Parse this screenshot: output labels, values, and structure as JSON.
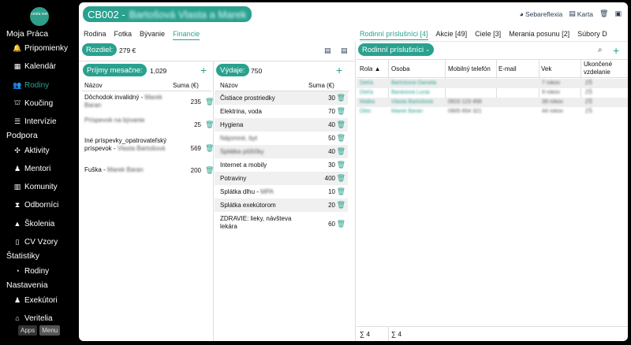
{
  "sidebar": {
    "logo_text": "cesta von",
    "sections": [
      {
        "title": "Moja Práca",
        "items": [
          {
            "label": "Pripomienky",
            "icon": "bell-icon"
          },
          {
            "label": "Kalendár",
            "icon": "calendar-icon"
          },
          {
            "label": "Rodiny",
            "icon": "users-icon",
            "active": true
          },
          {
            "label": "Koučing",
            "icon": "group-icon"
          },
          {
            "label": "Intervízie",
            "icon": "list-icon"
          }
        ]
      },
      {
        "title": "Podpora",
        "items": [
          {
            "label": "Aktivity",
            "icon": "puzzle-icon"
          },
          {
            "label": "Mentori",
            "icon": "person-icon"
          },
          {
            "label": "Komunity",
            "icon": "map-icon"
          },
          {
            "label": "Odborníci",
            "icon": "hourglass-icon"
          },
          {
            "label": "Školenia",
            "icon": "graduation-icon"
          },
          {
            "label": "CV Vzory",
            "icon": "document-icon"
          }
        ]
      },
      {
        "title": "Štatistiky",
        "items": [
          {
            "label": "Rodiny",
            "icon": "chart-icon"
          }
        ]
      },
      {
        "title": "Nastavenia",
        "items": [
          {
            "label": "Exekútori",
            "icon": "person-icon"
          },
          {
            "label": "Veritelia",
            "icon": "bank-icon"
          }
        ]
      }
    ],
    "apps_label": "Apps",
    "menu_label": "Menu"
  },
  "header": {
    "code": "CB002 -",
    "name": "Bartošová Vlasta a Marek",
    "actions": {
      "sebareflexia": "Sebareflexia",
      "karta": "Karta"
    }
  },
  "left_tabs": [
    "Rodina",
    "Fotka",
    "Bývanie",
    "Financie"
  ],
  "right_tabs": [
    "Rodinní príslušníci [4]",
    "Akcie [49]",
    "Ciele [3]",
    "Merania posunu [2]",
    "Súbory D"
  ],
  "finance": {
    "rozdiel_label": "Rozdiel:",
    "rozdiel_value": "279 €",
    "income": {
      "label": "Príjmy mesačne:",
      "total": "1,029",
      "col_name": "Názov",
      "col_sum": "Suma (€)",
      "rows": [
        {
          "name": "Dôchodok invalidný -",
          "name_blur": "Marek Baran",
          "amount": "235"
        },
        {
          "name": "",
          "name_blur": "Príspevok na bývanie",
          "amount": "25"
        },
        {
          "name": "Iné príspevky_opatrovateľský príspevok -",
          "name_blur": "Vlasta Bartošová",
          "amount": "569"
        },
        {
          "name": "Fuška -",
          "name_blur": "Marek Baran",
          "amount": "200"
        }
      ]
    },
    "expenses": {
      "label": "Výdaje:",
      "total": "750",
      "col_name": "Názov",
      "col_sum": "Suma (€)",
      "rows": [
        {
          "name": "Čistiace prostriedky",
          "amount": "30"
        },
        {
          "name": "Elektrina, voda",
          "amount": "70"
        },
        {
          "name": "Hygiena",
          "amount": "40"
        },
        {
          "name": "",
          "name_blur": "Nájomné, byt",
          "amount": "50"
        },
        {
          "name": "",
          "name_blur": "Splátka pôžičky",
          "amount": "40"
        },
        {
          "name": "Internet a mobily",
          "amount": "30"
        },
        {
          "name": "Potraviny",
          "amount": "400"
        },
        {
          "name": "Splátka dlhu -",
          "name_blur": "MPA",
          "amount": "10"
        },
        {
          "name": "Splátka exekútorom",
          "amount": "20"
        },
        {
          "name": "ZDRAVIE: lieky, návšteva lekára",
          "amount": "60"
        }
      ]
    }
  },
  "members": {
    "label": "Rodinní príslušníci",
    "columns": [
      "Rola ▲",
      "Osoba",
      "Mobilný telefón",
      "E-mail",
      "Vek",
      "Ukončené vzdelanie"
    ],
    "rows": [
      {
        "rola": "Dieťa",
        "osoba": "Bartošová Daniela",
        "phone": "",
        "vek": "7 rokov",
        "vzd": "ZŠ"
      },
      {
        "rola": "Dieťa",
        "osoba": "Baranová Lucia",
        "phone": "",
        "vek": "9 rokov",
        "vzd": "ZŠ"
      },
      {
        "rola": "Matka",
        "osoba": "Vlasta Bartošová",
        "phone": "0915 123 456",
        "vek": "39 rokov",
        "vzd": "ZŠ"
      },
      {
        "rola": "Otec",
        "osoba": "Marek Baran",
        "phone": "0905 654 321",
        "vek": "44 rokov",
        "vzd": "ZŠ"
      }
    ],
    "footer_rola": "∑ 4",
    "footer_osoba": "∑ 4"
  }
}
